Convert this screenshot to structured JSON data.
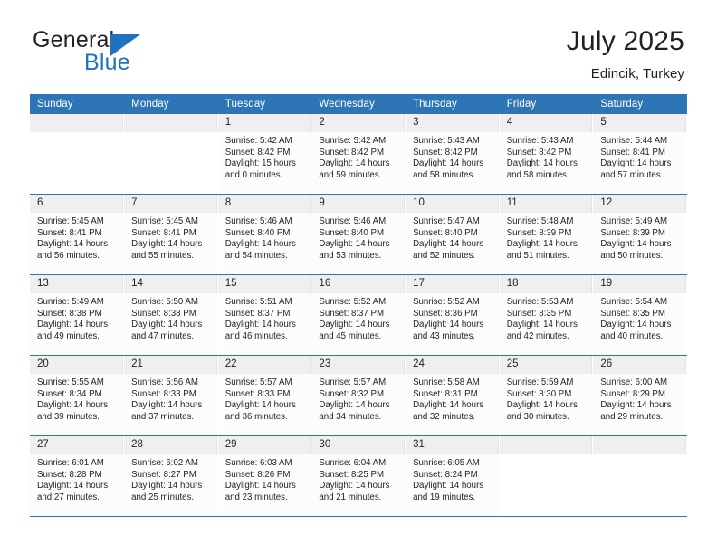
{
  "brand": {
    "name_part1": "General",
    "name_part2": "Blue",
    "triangle_color": "#1f72bd",
    "text_color": "#231f20"
  },
  "header": {
    "title": "July 2025",
    "location": "Edincik, Turkey"
  },
  "theme": {
    "header_bg": "#2e75b6",
    "header_text": "#ffffff",
    "daynum_bg": "#efefef",
    "cell_bg": "#fcfcfc",
    "row_divider": "#2e75b6"
  },
  "calendar": {
    "weekdays": [
      "Sunday",
      "Monday",
      "Tuesday",
      "Wednesday",
      "Thursday",
      "Friday",
      "Saturday"
    ],
    "weeks": [
      [
        {
          "day": "",
          "empty": true
        },
        {
          "day": "",
          "empty": true
        },
        {
          "day": "1",
          "sunrise": "Sunrise: 5:42 AM",
          "sunset": "Sunset: 8:42 PM",
          "daylight1": "Daylight: 15 hours",
          "daylight2": "and 0 minutes."
        },
        {
          "day": "2",
          "sunrise": "Sunrise: 5:42 AM",
          "sunset": "Sunset: 8:42 PM",
          "daylight1": "Daylight: 14 hours",
          "daylight2": "and 59 minutes."
        },
        {
          "day": "3",
          "sunrise": "Sunrise: 5:43 AM",
          "sunset": "Sunset: 8:42 PM",
          "daylight1": "Daylight: 14 hours",
          "daylight2": "and 58 minutes."
        },
        {
          "day": "4",
          "sunrise": "Sunrise: 5:43 AM",
          "sunset": "Sunset: 8:42 PM",
          "daylight1": "Daylight: 14 hours",
          "daylight2": "and 58 minutes."
        },
        {
          "day": "5",
          "sunrise": "Sunrise: 5:44 AM",
          "sunset": "Sunset: 8:41 PM",
          "daylight1": "Daylight: 14 hours",
          "daylight2": "and 57 minutes."
        }
      ],
      [
        {
          "day": "6",
          "sunrise": "Sunrise: 5:45 AM",
          "sunset": "Sunset: 8:41 PM",
          "daylight1": "Daylight: 14 hours",
          "daylight2": "and 56 minutes."
        },
        {
          "day": "7",
          "sunrise": "Sunrise: 5:45 AM",
          "sunset": "Sunset: 8:41 PM",
          "daylight1": "Daylight: 14 hours",
          "daylight2": "and 55 minutes."
        },
        {
          "day": "8",
          "sunrise": "Sunrise: 5:46 AM",
          "sunset": "Sunset: 8:40 PM",
          "daylight1": "Daylight: 14 hours",
          "daylight2": "and 54 minutes."
        },
        {
          "day": "9",
          "sunrise": "Sunrise: 5:46 AM",
          "sunset": "Sunset: 8:40 PM",
          "daylight1": "Daylight: 14 hours",
          "daylight2": "and 53 minutes."
        },
        {
          "day": "10",
          "sunrise": "Sunrise: 5:47 AM",
          "sunset": "Sunset: 8:40 PM",
          "daylight1": "Daylight: 14 hours",
          "daylight2": "and 52 minutes."
        },
        {
          "day": "11",
          "sunrise": "Sunrise: 5:48 AM",
          "sunset": "Sunset: 8:39 PM",
          "daylight1": "Daylight: 14 hours",
          "daylight2": "and 51 minutes."
        },
        {
          "day": "12",
          "sunrise": "Sunrise: 5:49 AM",
          "sunset": "Sunset: 8:39 PM",
          "daylight1": "Daylight: 14 hours",
          "daylight2": "and 50 minutes."
        }
      ],
      [
        {
          "day": "13",
          "sunrise": "Sunrise: 5:49 AM",
          "sunset": "Sunset: 8:38 PM",
          "daylight1": "Daylight: 14 hours",
          "daylight2": "and 49 minutes."
        },
        {
          "day": "14",
          "sunrise": "Sunrise: 5:50 AM",
          "sunset": "Sunset: 8:38 PM",
          "daylight1": "Daylight: 14 hours",
          "daylight2": "and 47 minutes."
        },
        {
          "day": "15",
          "sunrise": "Sunrise: 5:51 AM",
          "sunset": "Sunset: 8:37 PM",
          "daylight1": "Daylight: 14 hours",
          "daylight2": "and 46 minutes."
        },
        {
          "day": "16",
          "sunrise": "Sunrise: 5:52 AM",
          "sunset": "Sunset: 8:37 PM",
          "daylight1": "Daylight: 14 hours",
          "daylight2": "and 45 minutes."
        },
        {
          "day": "17",
          "sunrise": "Sunrise: 5:52 AM",
          "sunset": "Sunset: 8:36 PM",
          "daylight1": "Daylight: 14 hours",
          "daylight2": "and 43 minutes."
        },
        {
          "day": "18",
          "sunrise": "Sunrise: 5:53 AM",
          "sunset": "Sunset: 8:35 PM",
          "daylight1": "Daylight: 14 hours",
          "daylight2": "and 42 minutes."
        },
        {
          "day": "19",
          "sunrise": "Sunrise: 5:54 AM",
          "sunset": "Sunset: 8:35 PM",
          "daylight1": "Daylight: 14 hours",
          "daylight2": "and 40 minutes."
        }
      ],
      [
        {
          "day": "20",
          "sunrise": "Sunrise: 5:55 AM",
          "sunset": "Sunset: 8:34 PM",
          "daylight1": "Daylight: 14 hours",
          "daylight2": "and 39 minutes."
        },
        {
          "day": "21",
          "sunrise": "Sunrise: 5:56 AM",
          "sunset": "Sunset: 8:33 PM",
          "daylight1": "Daylight: 14 hours",
          "daylight2": "and 37 minutes."
        },
        {
          "day": "22",
          "sunrise": "Sunrise: 5:57 AM",
          "sunset": "Sunset: 8:33 PM",
          "daylight1": "Daylight: 14 hours",
          "daylight2": "and 36 minutes."
        },
        {
          "day": "23",
          "sunrise": "Sunrise: 5:57 AM",
          "sunset": "Sunset: 8:32 PM",
          "daylight1": "Daylight: 14 hours",
          "daylight2": "and 34 minutes."
        },
        {
          "day": "24",
          "sunrise": "Sunrise: 5:58 AM",
          "sunset": "Sunset: 8:31 PM",
          "daylight1": "Daylight: 14 hours",
          "daylight2": "and 32 minutes."
        },
        {
          "day": "25",
          "sunrise": "Sunrise: 5:59 AM",
          "sunset": "Sunset: 8:30 PM",
          "daylight1": "Daylight: 14 hours",
          "daylight2": "and 30 minutes."
        },
        {
          "day": "26",
          "sunrise": "Sunrise: 6:00 AM",
          "sunset": "Sunset: 8:29 PM",
          "daylight1": "Daylight: 14 hours",
          "daylight2": "and 29 minutes."
        }
      ],
      [
        {
          "day": "27",
          "sunrise": "Sunrise: 6:01 AM",
          "sunset": "Sunset: 8:28 PM",
          "daylight1": "Daylight: 14 hours",
          "daylight2": "and 27 minutes."
        },
        {
          "day": "28",
          "sunrise": "Sunrise: 6:02 AM",
          "sunset": "Sunset: 8:27 PM",
          "daylight1": "Daylight: 14 hours",
          "daylight2": "and 25 minutes."
        },
        {
          "day": "29",
          "sunrise": "Sunrise: 6:03 AM",
          "sunset": "Sunset: 8:26 PM",
          "daylight1": "Daylight: 14 hours",
          "daylight2": "and 23 minutes."
        },
        {
          "day": "30",
          "sunrise": "Sunrise: 6:04 AM",
          "sunset": "Sunset: 8:25 PM",
          "daylight1": "Daylight: 14 hours",
          "daylight2": "and 21 minutes."
        },
        {
          "day": "31",
          "sunrise": "Sunrise: 6:05 AM",
          "sunset": "Sunset: 8:24 PM",
          "daylight1": "Daylight: 14 hours",
          "daylight2": "and 19 minutes."
        },
        {
          "day": "",
          "empty": true
        },
        {
          "day": "",
          "empty": true
        }
      ]
    ]
  }
}
